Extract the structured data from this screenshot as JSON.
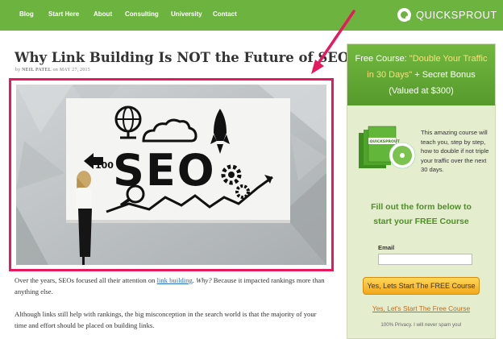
{
  "nav": {
    "items": [
      {
        "label": "Blog"
      },
      {
        "label": "Start Here"
      },
      {
        "label": "About"
      },
      {
        "label": "Consulting"
      },
      {
        "label": "University"
      },
      {
        "label": "Contact"
      }
    ],
    "logo_text": "QUICKSPROUT"
  },
  "article": {
    "title": "Why Link Building Is NOT the Future of SEO",
    "byline": {
      "prefix": "by ",
      "author": "NEIL PATEL",
      "date": " on MAY 27, 2015"
    },
    "hero_image": {
      "text": "SEO",
      "small_text": "100"
    },
    "p1": {
      "before": "Over the years, SEOs focused all their attention on ",
      "link": "link building",
      "middle": ". ",
      "italic": "Why?",
      "after": " Because it impacted rankings more than anything else."
    },
    "p2": "Although links still help with rankings, the big misconception in the search world is that the majority of your time and effort should be placed on building links."
  },
  "sidebar": {
    "head": {
      "prefix": "Free Course: ",
      "quote1": "\"Double Your Traffic",
      "quote2": "in 30 Days\"",
      "bonus": " + Secret Bonus",
      "valued": "(Valued at $300)"
    },
    "product_brand": "QUICKSPROUT",
    "product_desc": "This amazing course will teach you, step by step, how to double if not triple your traffic over the next 30 days.",
    "cta_line1": "Fill out the form below to",
    "cta_line2": "start your FREE Course",
    "email_label": "Email",
    "email_value": "",
    "button_label": "Yes, Lets Start The FREE Course",
    "alt_link": "Yes, Let's Start The Free Course",
    "privacy": "100% Privacy. I will never spam you!"
  },
  "colors": {
    "nav_green": "#6cb33f",
    "highlight_pink": "#e6195f",
    "cta_orange": "#f2a81a"
  }
}
